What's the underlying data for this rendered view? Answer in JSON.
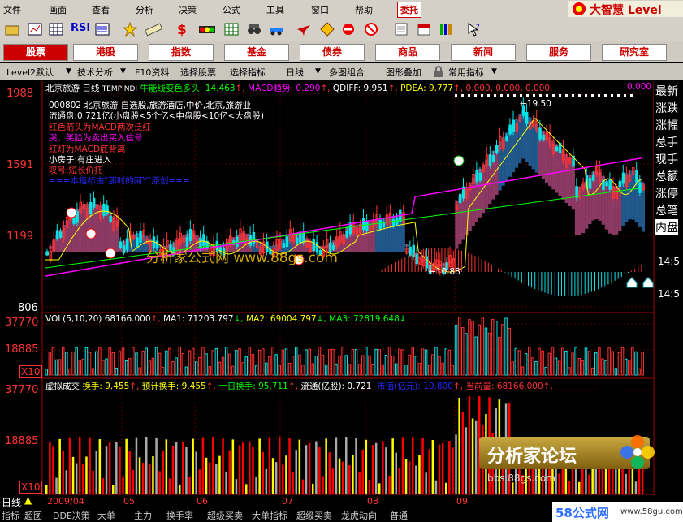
{
  "menu": {
    "items": [
      "文件",
      "画面",
      "查看",
      "分析",
      "决策",
      "公式",
      "工具",
      "窗口",
      "帮助"
    ],
    "trade_button": "委托",
    "brand": "大智慧 Level"
  },
  "toolbar": {
    "icons": [
      "open-icon",
      "chart-icon",
      "grid-icon",
      "rsi-icon",
      "list-icon",
      "star-icon",
      "ruler-icon",
      "dollar-icon",
      "traffic-icon",
      "grid2-icon",
      "binoculars-icon",
      "car-icon",
      "plane-icon",
      "diamond-icon",
      "no-icon",
      "forbid-icon",
      "eye-icon",
      "notepad-icon",
      "calendar-icon",
      "books-icon",
      "cursor-help-icon"
    ],
    "rsi_label": "RSI"
  },
  "nav": {
    "items": [
      "股票",
      "港股",
      "指数",
      "基金",
      "债券",
      "商品",
      "新闻",
      "服务",
      "研究室"
    ],
    "active": "股票"
  },
  "funcbar": {
    "level2": "Level2默认",
    "items": [
      "技术分析",
      "F10资料",
      "选择股票",
      "选择指标",
      "日线",
      "多图组合",
      "图形叠加",
      "常用指标"
    ]
  },
  "chart": {
    "title_stock": "北京旅游",
    "title_period": "日线",
    "indicator_name": "TEMPINDI",
    "line1_label": "牛能线变色多头:",
    "line1_value": "14.463",
    "macd_label": "MACD趋势:",
    "macd_value": "0.290",
    "qdiff_label": "QDIFF:",
    "qdiff_value": "9.951",
    "pdea_label": "PDEA:",
    "pdea_value": "9.777",
    "zero1": "0.000, 0.000, 0.000,",
    "zero2": "0.000",
    "y_labels": [
      "1988",
      "1591",
      "1199",
      "806"
    ],
    "peak_label": "←19.50",
    "low_label": "←10.88",
    "info": {
      "line1": "000802 北京旅游 自选股,旅游酒店,中价,北京,旅游业",
      "line2": "流通盘:0.721亿(小盘股<5个亿<中盘股<10亿<大盘股)",
      "line3": "红色箭头为MACD两次泛红",
      "line4": "哭、笑脸为卖出买入信号",
      "line5": "红灯为MACD底背离",
      "line6": "小房子:有庄进入",
      "line7": "叹号:短长价托",
      "line8": "===本指标由\"那时的阿Y\"原创==="
    },
    "watermark": "分析家公式网 www.88gs.com"
  },
  "vol": {
    "label": "VOL(5,10,20)",
    "value": "68166.000",
    "ma1_label": "MA1:",
    "ma1_value": "71203.797",
    "ma2_label": "MA2:",
    "ma2_value": "69004.797",
    "ma3_label": "MA3:",
    "ma3_value": "72819.648",
    "y_top": "37770",
    "y_mid": "18885",
    "x10": "X10"
  },
  "vturn": {
    "label": "虚拟成交",
    "hs_label": "换手:",
    "hs_value": "9.455",
    "yjhs_label": "预计换手:",
    "yjhs_value": "9.455",
    "sr_label": "十日换手:",
    "sr_value": "95.711",
    "lt_label": "流通(亿股):",
    "lt_value": "0.721",
    "sz_label": "市值(亿元):",
    "sz_value": "10.800",
    "dql_label": "当前量:",
    "dql_value": "68166.000",
    "y_top": "37770",
    "y_mid": "18885",
    "x10": "X10"
  },
  "right_panel": [
    "最新",
    "涨跌",
    "涨幅",
    "总手",
    "现手",
    "总额",
    "涨停",
    "总笔",
    "内盘"
  ],
  "right_times": [
    "14:5",
    "14:5"
  ],
  "dates": [
    "2009/04",
    "05",
    "06",
    "07",
    "08",
    "09"
  ],
  "period_label": "日线",
  "bottom_tabs": [
    "指标",
    "超图",
    "DDE决策",
    "大单",
    "主力",
    "换手率",
    "超级买卖",
    "大单指标",
    "超级买卖",
    "龙虎动向",
    "普通"
  ],
  "forum": {
    "title": "分析家论坛",
    "url": "bbs.88gs.com",
    "site": "58公式网",
    "site_url": "www.58gu.com"
  },
  "colors": {
    "up": "#ff3232",
    "down": "#00e5e5",
    "grid": "#800000",
    "yellow": "#ffff00",
    "magenta": "#ff00ff",
    "green": "#00ff00"
  }
}
